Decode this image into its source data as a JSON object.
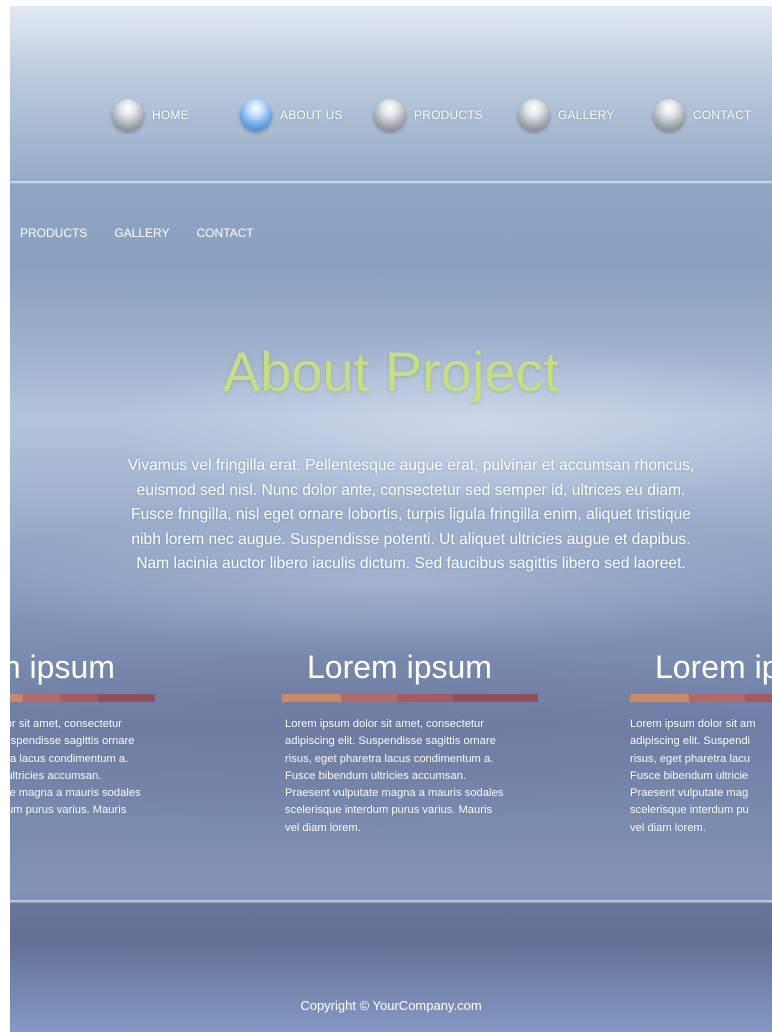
{
  "nav_main": [
    {
      "label": "HOME",
      "active": false
    },
    {
      "label": "ABOUT US",
      "active": true
    },
    {
      "label": "PRODUCTS",
      "active": false
    },
    {
      "label": "GALLERY",
      "active": false
    },
    {
      "label": "CONTACT",
      "active": false
    }
  ],
  "nav_sub": [
    "PRODUCTS",
    "GALLERY",
    "CONTACT"
  ],
  "main": {
    "title": "About Project",
    "intro": [
      "Vivamus vel fringilla erat. Pellentesque augue erat, pulvinar et accumsan rhoncus,",
      "euismod sed nisl. Nunc dolor ante, consectetur sed semper id, ultrices eu diam.",
      "Fusce fringilla, nisl eget ornare lobortis, turpis ligula fringilla enim, aliquet tristique",
      "nibh lorem nec augue. Suspendisse potenti. Ut aliquet ultricies augue et dapibus.",
      "Nam lacinia auctor libero iaculis dictum. Sed faucibus sagittis libero sed laoreet."
    ]
  },
  "columns": [
    {
      "title": "m ipsum",
      "lines": [
        "olor sit amet, consectetur",
        "Suspendisse sagittis ornare",
        "etra lacus condimentum a.",
        "n ultricies accumsan.",
        "tate magna a mauris sodales",
        "rdum purus varius. Mauris"
      ]
    },
    {
      "title": "Lorem ipsum",
      "lines": [
        "Lorem ipsum dolor sit amet, consectetur",
        "adipiscing elit. Suspendisse sagittis ornare",
        "risus, eget pharetra lacus condimentum a.",
        "Fusce bibendum ultricies accumsan.",
        "Praesent vulputate magna a mauris sodales",
        "scelerisque interdum purus varius. Mauris",
        "vel diam lorem."
      ]
    },
    {
      "title": "Lorem ip",
      "lines": [
        "Lorem ipsum dolor sit am",
        "adipiscing elit. Suspendi",
        "risus, eget pharetra lacu",
        "Fusce bibendum ultricie",
        "Praesent vulputate mag",
        "scelerisque interdum pu",
        "vel diam lorem."
      ]
    }
  ],
  "footer": {
    "copyright": "Copyright © YourCompany.com"
  },
  "colors": {
    "title_accent": "#c8dd84",
    "active_ball": "#6ea8ea",
    "bar": "#b06a6a"
  }
}
